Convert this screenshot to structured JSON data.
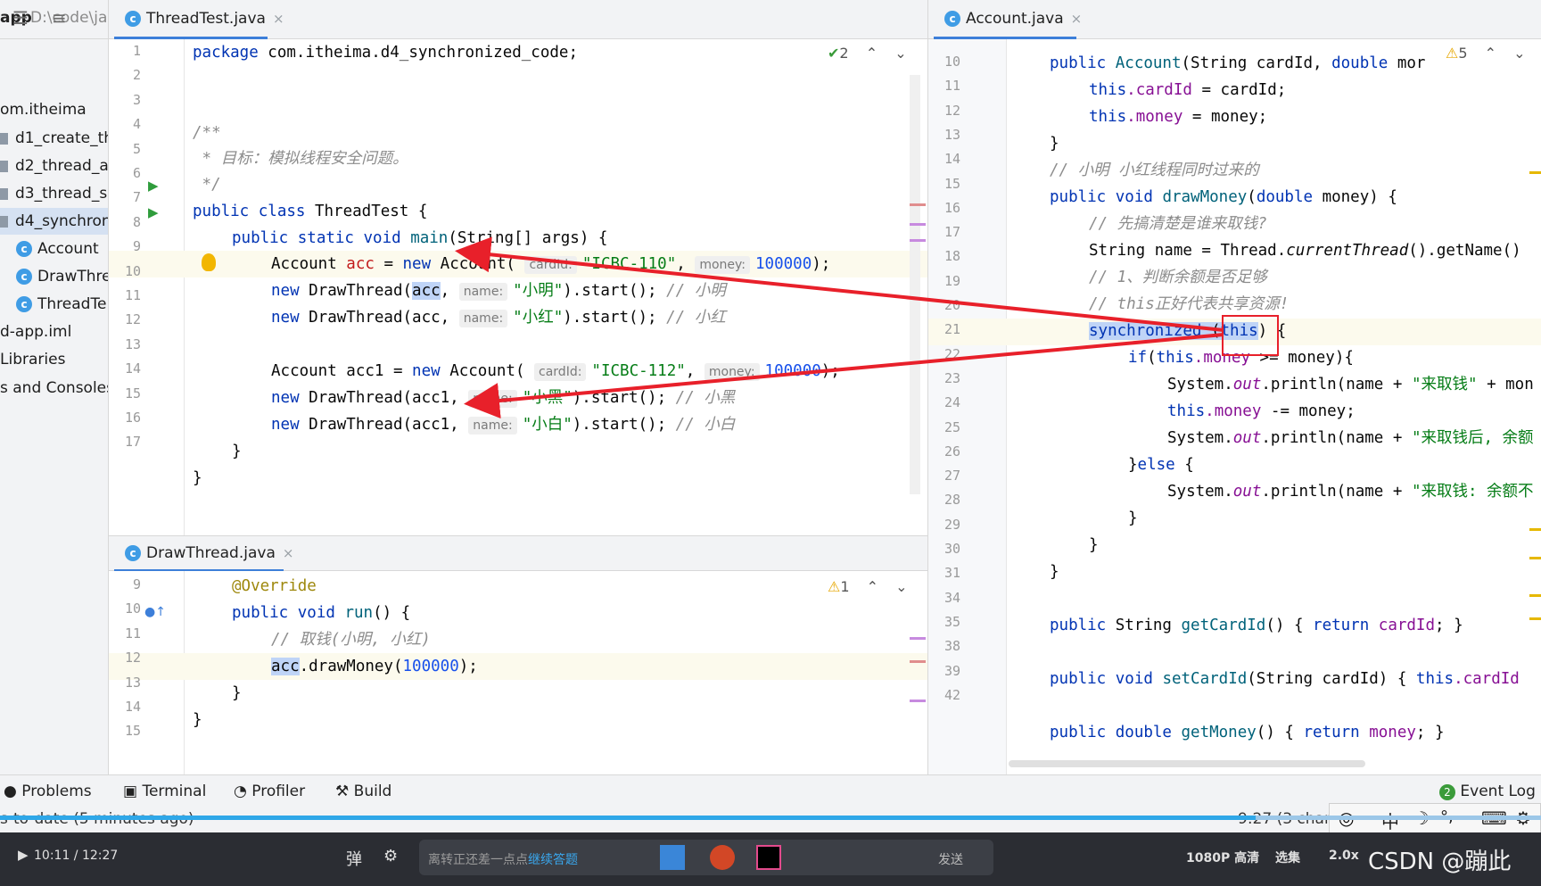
{
  "project": {
    "title": "app",
    "path": "D:\\code\\ja",
    "items": [
      "om.itheima",
      "d1_create_thr",
      "d2_thread_ap",
      "d3_thread_sa",
      "d4_synchroni",
      "Account",
      "DrawThre",
      "ThreadTe",
      "d-app.iml",
      "Libraries",
      "s and Consoles"
    ]
  },
  "tabs": {
    "left_tab": "ThreadTest.java",
    "right_tab": "Account.java",
    "bottom_tab": "DrawThread.java",
    "close_glyph": "×"
  },
  "badges": {
    "left_check": "2",
    "right_warn": "5",
    "bottom_warn": "1"
  },
  "threadtest": {
    "line_numbers": [
      "1",
      "2",
      "3",
      "4",
      "5",
      "6",
      "7",
      "8",
      "9",
      "10",
      "11",
      "12",
      "13",
      "14",
      "15",
      "16",
      "17"
    ],
    "l1_kw": "package",
    "l1_rest": " com.itheima.d4_synchronized_code;",
    "l3": "/**",
    "l4": " * 目标：模拟线程安全问题。",
    "l5": " */",
    "l6_kw": "public class",
    "l6_rest": " ThreadTest {",
    "l7_kw": "public static void",
    "l7_fn": " main",
    "l7_rest": "(String[] args) {",
    "l8_a": "Account ",
    "l8_var": "acc",
    "l8_b": " = ",
    "l8_new": "new",
    "l8_c": " Account( ",
    "l8_hint1": "cardId:",
    "l8_str": "\"ICBC-110\"",
    "l8_d": ", ",
    "l8_hint2": "money:",
    "l8_num": "100000",
    "l8_e": ");",
    "l9_new": "new",
    "l9_a": " DrawThread(",
    "l9_sel": "acc",
    "l9_b": ", ",
    "l9_hint": "name:",
    "l9_str": "\"小明\"",
    "l9_c": ").start(); ",
    "l9_cm": "// 小明",
    "l10_new": "new",
    "l10_a": " DrawThread(acc, ",
    "l10_hint": "name:",
    "l10_str": "\"小红\"",
    "l10_c": ").start(); ",
    "l10_cm": "// 小红",
    "l12_a": "Account acc1 = ",
    "l12_new": "new",
    "l12_b": " Account( ",
    "l12_hint1": "cardId:",
    "l12_str": "\"ICBC-112\"",
    "l12_c": ", ",
    "l12_hint2": "money:",
    "l12_num": "100000",
    "l12_d": ");",
    "l13_new": "new",
    "l13_a": " DrawThread(acc1, ",
    "l13_hint": "name:",
    "l13_str": "\"小黑\"",
    "l13_c": ").start(); ",
    "l13_cm": "// 小黑",
    "l14_new": "new",
    "l14_a": " DrawThread(acc1, ",
    "l14_hint": "name:",
    "l14_str": "\"小白\"",
    "l14_c": ").start(); ",
    "l14_cm": "// 小白",
    "l15": "}",
    "l16": "}"
  },
  "drawthread": {
    "line_numbers": [
      "9",
      "10",
      "11",
      "12",
      "13",
      "14",
      "15"
    ],
    "l9": "@Override",
    "l10_kw": "public void",
    "l10_fn": " run",
    "l10_rest": "() {",
    "l11": "// 取钱(小明, 小红)",
    "l12_sel": "acc",
    "l12_a": ".drawMoney(",
    "l12_num": "100000",
    "l12_b": ");",
    "l13": "}",
    "l14": "}"
  },
  "account": {
    "line_numbers": [
      "10",
      "11",
      "12",
      "13",
      "14",
      "15",
      "16",
      "17",
      "18",
      "19",
      "20",
      "21",
      "22",
      "23",
      "24",
      "25",
      "26",
      "27",
      "28",
      "29",
      "30",
      "31",
      "34",
      "35",
      "38",
      "39",
      "42"
    ],
    "l10_kw": "public",
    "l10_fn": " Account",
    "l10_a": "(String cardId, ",
    "l10_kw2": "double",
    "l10_b": " mor",
    "l11_kw": "this",
    "l11_fld": ".cardId",
    "l11_rest": " = cardId;",
    "l12_kw": "this",
    "l12_fld": ".money",
    "l12_rest": " = money;",
    "l13": "}",
    "l14": "// 小明 小红线程同时过来的",
    "l15_kw": "public void",
    "l15_fn": " drawMoney",
    "l15_a": "(",
    "l15_kw2": "double",
    "l15_b": " money) {",
    "l16": "// 先搞清楚是谁来取钱?",
    "l17_a": "String name = Thread.",
    "l17_it": "currentThread",
    "l17_b": "().getName()",
    "l18": "// 1、判断余额是否足够",
    "l19": "// this正好代表共享资源!",
    "l20_kw": "synchronized",
    "l20_a": " (",
    "l20_kw2": "this",
    "l20_b": ") {",
    "l21_kw": "if",
    "l21_a": "(",
    "l21_kw2": "this",
    "l21_fld": ".money",
    "l21_b": " >= money){",
    "l22_a": "System.",
    "l22_it": "out",
    "l22_b": ".println(name + ",
    "l22_str": "\"来取钱\"",
    "l22_c": " + mon",
    "l23_kw": "this",
    "l23_fld": ".money",
    "l23_rest": " -= money;",
    "l24_a": "System.",
    "l24_it": "out",
    "l24_b": ".println(name + ",
    "l24_str": "\"来取钱后, 余额",
    "l25_a": "}",
    "l25_kw": "else",
    "l25_b": " {",
    "l26_a": "System.",
    "l26_it": "out",
    "l26_b": ".println(name + ",
    "l26_str": "\"来取钱: 余额不",
    "l27": "}",
    "l28": "}",
    "l29": "}",
    "l31_kw": "public",
    "l31_a": " String ",
    "l31_fn": "getCardId",
    "l31_b": "() { ",
    "l31_kw2": "return",
    "l31_fld": " cardId",
    "l31_c": "; }",
    "l35_kw": "public void",
    "l35_fn": " setCardId",
    "l35_a": "(String cardId) { ",
    "l35_kw2": "this",
    "l35_fld": ".cardId",
    "l39_kw": "public double",
    "l39_fn": " getMoney",
    "l39_a": "() { ",
    "l39_kw2": "return",
    "l39_fld": " money",
    "l39_b": "; }"
  },
  "toolwindows": {
    "problems": "Problems",
    "terminal": "Terminal",
    "profiler": "Profiler",
    "build": "Build",
    "event_log": "Event Log",
    "event_count": "2"
  },
  "status": {
    "left": "s-to-date (5 minutes ago)",
    "right": "9:27 (3 chars"
  },
  "ime": {
    "zh": "中",
    "moon": "☽",
    "dot": "°,"
  },
  "player": {
    "time": "10:11 / 12:27",
    "danmu_placeholder": "离转正还差一点点",
    "danmu_link": "继续答题",
    "send": "发送",
    "quality": "1080P 高清",
    "episodes": "选集",
    "speed": "2.0x",
    "watermark": "CSDN @蹦此"
  },
  "colors": {
    "accent": "#3d7fd9",
    "arrow": "#e8202a",
    "progress": "#2fa7e8"
  },
  "progress": {
    "played_fraction": 0.815
  }
}
